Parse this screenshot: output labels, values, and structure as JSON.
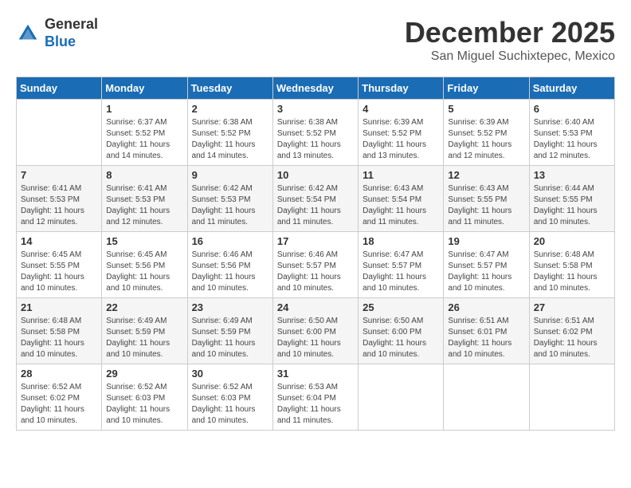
{
  "logo": {
    "general": "General",
    "blue": "Blue"
  },
  "header": {
    "month": "December 2025",
    "location": "San Miguel Suchixtepec, Mexico"
  },
  "days_of_week": [
    "Sunday",
    "Monday",
    "Tuesday",
    "Wednesday",
    "Thursday",
    "Friday",
    "Saturday"
  ],
  "weeks": [
    [
      {
        "day": "",
        "sunrise": "",
        "sunset": "",
        "daylight": ""
      },
      {
        "day": "1",
        "sunrise": "Sunrise: 6:37 AM",
        "sunset": "Sunset: 5:52 PM",
        "daylight": "Daylight: 11 hours and 14 minutes."
      },
      {
        "day": "2",
        "sunrise": "Sunrise: 6:38 AM",
        "sunset": "Sunset: 5:52 PM",
        "daylight": "Daylight: 11 hours and 14 minutes."
      },
      {
        "day": "3",
        "sunrise": "Sunrise: 6:38 AM",
        "sunset": "Sunset: 5:52 PM",
        "daylight": "Daylight: 11 hours and 13 minutes."
      },
      {
        "day": "4",
        "sunrise": "Sunrise: 6:39 AM",
        "sunset": "Sunset: 5:52 PM",
        "daylight": "Daylight: 11 hours and 13 minutes."
      },
      {
        "day": "5",
        "sunrise": "Sunrise: 6:39 AM",
        "sunset": "Sunset: 5:52 PM",
        "daylight": "Daylight: 11 hours and 12 minutes."
      },
      {
        "day": "6",
        "sunrise": "Sunrise: 6:40 AM",
        "sunset": "Sunset: 5:53 PM",
        "daylight": "Daylight: 11 hours and 12 minutes."
      }
    ],
    [
      {
        "day": "7",
        "sunrise": "Sunrise: 6:41 AM",
        "sunset": "Sunset: 5:53 PM",
        "daylight": "Daylight: 11 hours and 12 minutes."
      },
      {
        "day": "8",
        "sunrise": "Sunrise: 6:41 AM",
        "sunset": "Sunset: 5:53 PM",
        "daylight": "Daylight: 11 hours and 12 minutes."
      },
      {
        "day": "9",
        "sunrise": "Sunrise: 6:42 AM",
        "sunset": "Sunset: 5:53 PM",
        "daylight": "Daylight: 11 hours and 11 minutes."
      },
      {
        "day": "10",
        "sunrise": "Sunrise: 6:42 AM",
        "sunset": "Sunset: 5:54 PM",
        "daylight": "Daylight: 11 hours and 11 minutes."
      },
      {
        "day": "11",
        "sunrise": "Sunrise: 6:43 AM",
        "sunset": "Sunset: 5:54 PM",
        "daylight": "Daylight: 11 hours and 11 minutes."
      },
      {
        "day": "12",
        "sunrise": "Sunrise: 6:43 AM",
        "sunset": "Sunset: 5:55 PM",
        "daylight": "Daylight: 11 hours and 11 minutes."
      },
      {
        "day": "13",
        "sunrise": "Sunrise: 6:44 AM",
        "sunset": "Sunset: 5:55 PM",
        "daylight": "Daylight: 11 hours and 10 minutes."
      }
    ],
    [
      {
        "day": "14",
        "sunrise": "Sunrise: 6:45 AM",
        "sunset": "Sunset: 5:55 PM",
        "daylight": "Daylight: 11 hours and 10 minutes."
      },
      {
        "day": "15",
        "sunrise": "Sunrise: 6:45 AM",
        "sunset": "Sunset: 5:56 PM",
        "daylight": "Daylight: 11 hours and 10 minutes."
      },
      {
        "day": "16",
        "sunrise": "Sunrise: 6:46 AM",
        "sunset": "Sunset: 5:56 PM",
        "daylight": "Daylight: 11 hours and 10 minutes."
      },
      {
        "day": "17",
        "sunrise": "Sunrise: 6:46 AM",
        "sunset": "Sunset: 5:57 PM",
        "daylight": "Daylight: 11 hours and 10 minutes."
      },
      {
        "day": "18",
        "sunrise": "Sunrise: 6:47 AM",
        "sunset": "Sunset: 5:57 PM",
        "daylight": "Daylight: 11 hours and 10 minutes."
      },
      {
        "day": "19",
        "sunrise": "Sunrise: 6:47 AM",
        "sunset": "Sunset: 5:57 PM",
        "daylight": "Daylight: 11 hours and 10 minutes."
      },
      {
        "day": "20",
        "sunrise": "Sunrise: 6:48 AM",
        "sunset": "Sunset: 5:58 PM",
        "daylight": "Daylight: 11 hours and 10 minutes."
      }
    ],
    [
      {
        "day": "21",
        "sunrise": "Sunrise: 6:48 AM",
        "sunset": "Sunset: 5:58 PM",
        "daylight": "Daylight: 11 hours and 10 minutes."
      },
      {
        "day": "22",
        "sunrise": "Sunrise: 6:49 AM",
        "sunset": "Sunset: 5:59 PM",
        "daylight": "Daylight: 11 hours and 10 minutes."
      },
      {
        "day": "23",
        "sunrise": "Sunrise: 6:49 AM",
        "sunset": "Sunset: 5:59 PM",
        "daylight": "Daylight: 11 hours and 10 minutes."
      },
      {
        "day": "24",
        "sunrise": "Sunrise: 6:50 AM",
        "sunset": "Sunset: 6:00 PM",
        "daylight": "Daylight: 11 hours and 10 minutes."
      },
      {
        "day": "25",
        "sunrise": "Sunrise: 6:50 AM",
        "sunset": "Sunset: 6:00 PM",
        "daylight": "Daylight: 11 hours and 10 minutes."
      },
      {
        "day": "26",
        "sunrise": "Sunrise: 6:51 AM",
        "sunset": "Sunset: 6:01 PM",
        "daylight": "Daylight: 11 hours and 10 minutes."
      },
      {
        "day": "27",
        "sunrise": "Sunrise: 6:51 AM",
        "sunset": "Sunset: 6:02 PM",
        "daylight": "Daylight: 11 hours and 10 minutes."
      }
    ],
    [
      {
        "day": "28",
        "sunrise": "Sunrise: 6:52 AM",
        "sunset": "Sunset: 6:02 PM",
        "daylight": "Daylight: 11 hours and 10 minutes."
      },
      {
        "day": "29",
        "sunrise": "Sunrise: 6:52 AM",
        "sunset": "Sunset: 6:03 PM",
        "daylight": "Daylight: 11 hours and 10 minutes."
      },
      {
        "day": "30",
        "sunrise": "Sunrise: 6:52 AM",
        "sunset": "Sunset: 6:03 PM",
        "daylight": "Daylight: 11 hours and 10 minutes."
      },
      {
        "day": "31",
        "sunrise": "Sunrise: 6:53 AM",
        "sunset": "Sunset: 6:04 PM",
        "daylight": "Daylight: 11 hours and 11 minutes."
      },
      {
        "day": "",
        "sunrise": "",
        "sunset": "",
        "daylight": ""
      },
      {
        "day": "",
        "sunrise": "",
        "sunset": "",
        "daylight": ""
      },
      {
        "day": "",
        "sunrise": "",
        "sunset": "",
        "daylight": ""
      }
    ]
  ]
}
